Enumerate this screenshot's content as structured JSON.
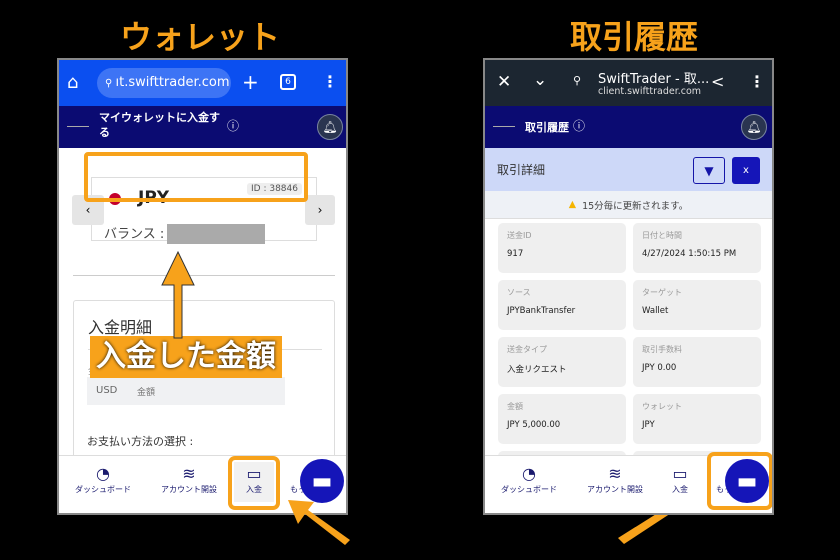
{
  "left": {
    "title": "ウォレット",
    "browser": {
      "url": "ıt.swifttrader.com",
      "tabs_count": "6",
      "plus": "+",
      "menu": "⋮"
    },
    "header": {
      "title": "マイウォレットに入金する"
    },
    "wallet": {
      "currency": "JPY",
      "id": "ID : 38846",
      "balance_label": "バランス :",
      "prev": "‹",
      "next": "›"
    },
    "deposit": {
      "title": "入金明細",
      "field_label": "金",
      "currency": "USD",
      "amount_placeholder": "金額",
      "payment_label": "お支払い方法の選択 :"
    },
    "annotation": "入金した金額",
    "nav": [
      "ダッシュボード",
      "アカウント開設",
      "入金",
      "もっと"
    ]
  },
  "right": {
    "title": "取引履歴",
    "browser": {
      "page_title": "SwiftTrader - 取...",
      "url": "client.swifttrader.com"
    },
    "header": {
      "title": "取引履歴"
    },
    "sub": {
      "title": "取引詳細"
    },
    "notice": "15分毎に更新されます。",
    "cells": [
      {
        "label": "送金ID",
        "value": "917"
      },
      {
        "label": "日付と時間",
        "value": "4/27/2024 1:50:15 PM"
      },
      {
        "label": "ソース",
        "value": "JPYBankTransfer"
      },
      {
        "label": "ターゲット",
        "value": "Wallet"
      },
      {
        "label": "送金タイプ",
        "value": "入金リクエスト"
      },
      {
        "label": "取引手数料",
        "value": "JPY 0.00"
      },
      {
        "label": "金額",
        "value": "JPY 5,000.00"
      },
      {
        "label": "ウォレット",
        "value": "JPY"
      }
    ],
    "nav": [
      "ダッシュボード",
      "アカウント開設",
      "入金",
      "もっと"
    ]
  },
  "colors": {
    "accent": "#f7a21b",
    "navy": "#0b0b72",
    "chrome_blue": "#0b4ff0",
    "chat": "#1515b8"
  }
}
